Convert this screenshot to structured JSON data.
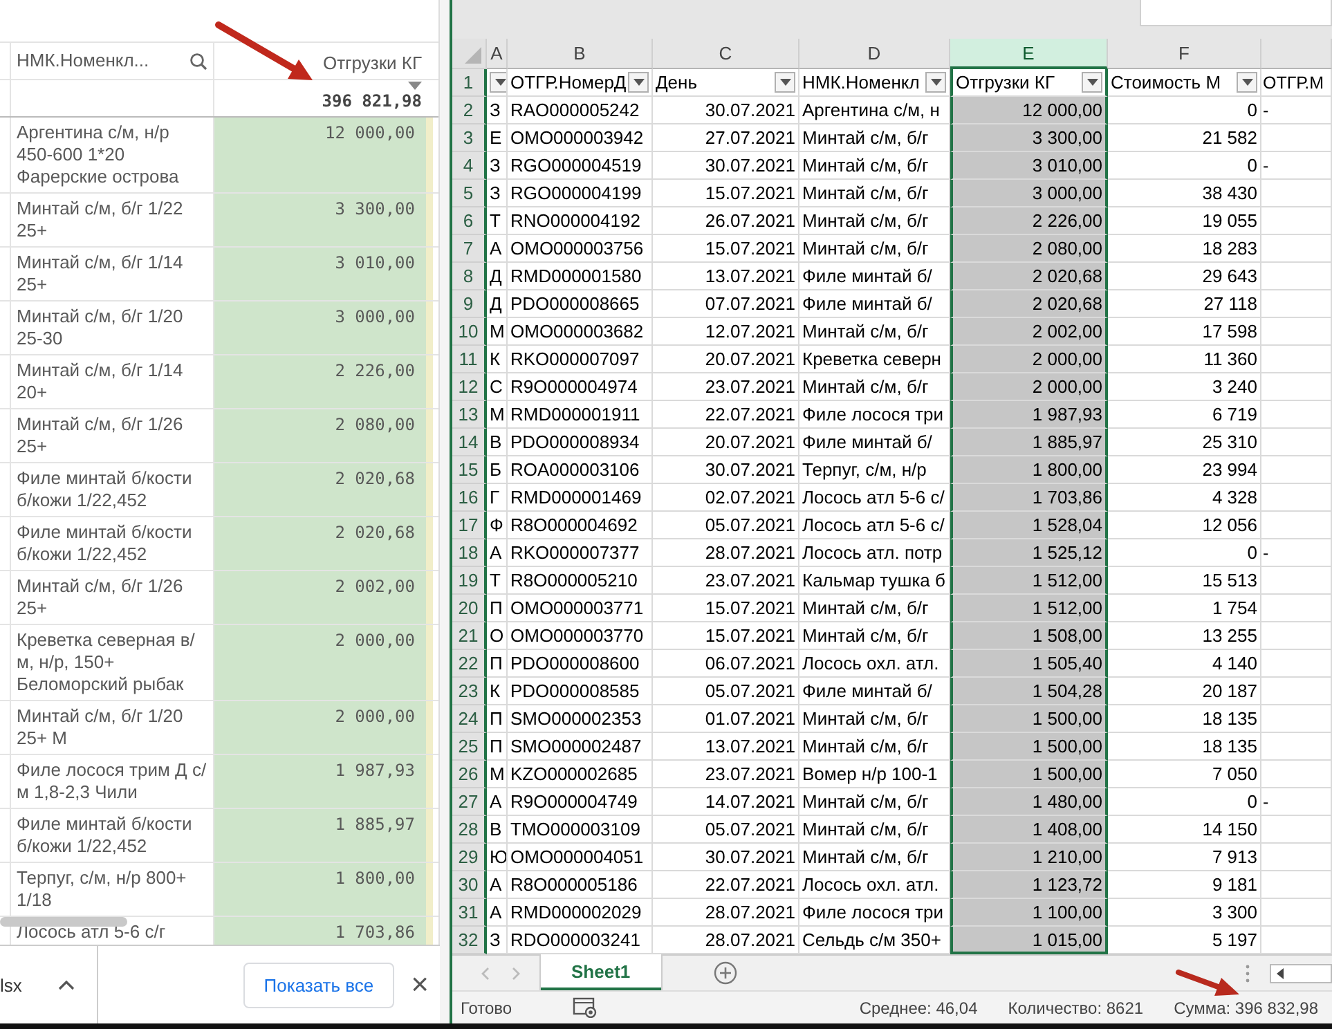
{
  "report_panel": {
    "columns": [
      {
        "label": "НМК.Номенкл..."
      },
      {
        "label": "Отгрузки КГ"
      }
    ],
    "total": "396 821,98",
    "rows": [
      {
        "name": "Аргентина с/м, н/р 450-600 1*20 Фарерские острова",
        "value": "12 000,00"
      },
      {
        "name": "Минтай с/м, б/г 1/22 25+",
        "value": "3 300,00"
      },
      {
        "name": "Минтай с/м, б/г 1/14 25+",
        "value": "3 010,00"
      },
      {
        "name": "Минтай с/м, б/г 1/20 25-30",
        "value": "3 000,00"
      },
      {
        "name": "Минтай с/м, б/г 1/14 20+",
        "value": "2 226,00"
      },
      {
        "name": "Минтай с/м, б/г 1/26 25+",
        "value": "2 080,00"
      },
      {
        "name": "Филе минтай б/кости б/кожи 1/22,452",
        "value": "2 020,68"
      },
      {
        "name": "Филе минтай б/кости б/кожи 1/22,452",
        "value": "2 020,68"
      },
      {
        "name": "Минтай с/м, б/г 1/26 25+",
        "value": "2 002,00"
      },
      {
        "name": "Креветка северная в/ м, н/р, 150+ Беломорский рыбак",
        "value": "2 000,00"
      },
      {
        "name": "Минтай с/м, б/г 1/20 25+ М",
        "value": "2 000,00"
      },
      {
        "name": "Филе лосося трим Д с/ м 1,8-2,3 Чили",
        "value": "1 987,93"
      },
      {
        "name": "Филе минтай б/кости б/кожи 1/22,452",
        "value": "1 885,97"
      },
      {
        "name": "Терпуг, с/м, н/р 800+ 1/18",
        "value": "1 800,00"
      },
      {
        "name": "Лосось атл 5-6 с/г",
        "value": "1 703,86"
      }
    ]
  },
  "download_bar": {
    "file_name": "lsx",
    "show_all_button": "Показать все",
    "close": "×"
  },
  "spreadsheet": {
    "column_letters": [
      {
        "letter": "A",
        "selected": false
      },
      {
        "letter": "B",
        "selected": false
      },
      {
        "letter": "C",
        "selected": false
      },
      {
        "letter": "D",
        "selected": false
      },
      {
        "letter": "E",
        "selected": true
      },
      {
        "letter": "F",
        "selected": false
      }
    ],
    "header_row": {
      "number": "1",
      "cells": [
        {
          "filter": true
        },
        {
          "label": "ОТГР.НомерД",
          "filter": true
        },
        {
          "label": "День",
          "filter": true
        },
        {
          "label": "НМК.Номенкл",
          "filter": true
        },
        {
          "label": "Отгрузки КГ",
          "filter": true
        },
        {
          "label": "Стоимость М",
          "filter": true
        },
        {
          "label": "ОТГР.М",
          "filter": false
        }
      ]
    },
    "rows": [
      {
        "number": "2",
        "cells": [
          "З",
          "RAO000005242",
          "30.07.2021",
          "Аргентина с/м, н",
          "12 000,00",
          "0"
        ],
        "column_7": "-"
      },
      {
        "number": "3",
        "cells": [
          "Е",
          "OMO000003942",
          "27.07.2021",
          "Минтай с/м, б/г",
          "3 300,00",
          "21 582"
        ]
      },
      {
        "number": "4",
        "cells": [
          "З",
          "RGO000004519",
          "30.07.2021",
          "Минтай с/м, б/г",
          "3 010,00",
          "0"
        ],
        "column_7": "-"
      },
      {
        "number": "5",
        "cells": [
          "З",
          "RGO000004199",
          "15.07.2021",
          "Минтай с/м, б/г",
          "3 000,00",
          "38 430"
        ]
      },
      {
        "number": "6",
        "cells": [
          "Т",
          "RNO000004192",
          "26.07.2021",
          "Минтай с/м, б/г",
          "2 226,00",
          "19 055"
        ]
      },
      {
        "number": "7",
        "cells": [
          "А",
          "OMO000003756",
          "15.07.2021",
          "Минтай с/м, б/г",
          "2 080,00",
          "18 283"
        ]
      },
      {
        "number": "8",
        "cells": [
          "Д",
          "RMD000001580",
          "13.07.2021",
          "Филе минтай б/",
          "2 020,68",
          "29 643"
        ]
      },
      {
        "number": "9",
        "cells": [
          "Д",
          "PDO000008665",
          "07.07.2021",
          "Филе минтай б/",
          "2 020,68",
          "27 118"
        ]
      },
      {
        "number": "10",
        "cells": [
          "М",
          "OMO000003682",
          "12.07.2021",
          "Минтай с/м, б/г",
          "2 002,00",
          "17 598"
        ]
      },
      {
        "number": "11",
        "cells": [
          "К",
          "RKO000007097",
          "20.07.2021",
          "Креветка северн",
          "2 000,00",
          "11 360"
        ]
      },
      {
        "number": "12",
        "cells": [
          "С",
          "R9O000004974",
          "23.07.2021",
          "Минтай с/м, б/г",
          "2 000,00",
          "3 240"
        ]
      },
      {
        "number": "13",
        "cells": [
          "М",
          "RMD000001911",
          "22.07.2021",
          "Филе лосося три",
          "1 987,93",
          "6 719"
        ]
      },
      {
        "number": "14",
        "cells": [
          "В",
          "PDO000008934",
          "20.07.2021",
          "Филе минтай б/",
          "1 885,97",
          "25 310"
        ]
      },
      {
        "number": "15",
        "cells": [
          "Б",
          "ROA000003106",
          "30.07.2021",
          "Терпуг, с/м, н/р",
          "1 800,00",
          "23 994"
        ]
      },
      {
        "number": "16",
        "cells": [
          "Г",
          "RMD000001469",
          "02.07.2021",
          "Лосось атл 5-6 с/",
          "1 703,86",
          "4 328"
        ]
      },
      {
        "number": "17",
        "cells": [
          "Ф",
          "R8O000004692",
          "05.07.2021",
          "Лосось атл 5-6 с/",
          "1 528,04",
          "12 056"
        ]
      },
      {
        "number": "18",
        "cells": [
          "А",
          "RKO000007377",
          "28.07.2021",
          "Лосось атл. потр",
          "1 525,12",
          "0"
        ],
        "column_7": "-"
      },
      {
        "number": "19",
        "cells": [
          "Т",
          "R8O000005210",
          "23.07.2021",
          "Кальмар тушка б",
          "1 512,00",
          "15 513"
        ]
      },
      {
        "number": "20",
        "cells": [
          "П",
          "OMO000003771",
          "15.07.2021",
          "Минтай с/м, б/г",
          "1 512,00",
          "1 754"
        ]
      },
      {
        "number": "21",
        "cells": [
          "О",
          "OMO000003770",
          "15.07.2021",
          "Минтай с/м, б/г",
          "1 508,00",
          "13 255"
        ]
      },
      {
        "number": "22",
        "cells": [
          "П",
          "PDO000008600",
          "06.07.2021",
          "Лосось охл. атл.",
          "1 505,40",
          "4 140"
        ]
      },
      {
        "number": "23",
        "cells": [
          "К",
          "PDO000008585",
          "05.07.2021",
          "Филе минтай б/",
          "1 504,28",
          "20 187"
        ]
      },
      {
        "number": "24",
        "cells": [
          "П",
          "SMO000002353",
          "01.07.2021",
          "Минтай с/м, б/г",
          "1 500,00",
          "18 135"
        ]
      },
      {
        "number": "25",
        "cells": [
          "П",
          "SMO000002487",
          "13.07.2021",
          "Минтай с/м, б/г",
          "1 500,00",
          "18 135"
        ]
      },
      {
        "number": "26",
        "cells": [
          "М",
          "KZO000002685",
          "23.07.2021",
          "Вомер н/р 100-1",
          "1 500,00",
          "7 050"
        ]
      },
      {
        "number": "27",
        "cells": [
          "А",
          "R9O000004749",
          "14.07.2021",
          "Минтай с/м, б/г",
          "1 480,00",
          "0"
        ],
        "column_7": "-"
      },
      {
        "number": "28",
        "cells": [
          "В",
          "TMO000003109",
          "05.07.2021",
          "Минтай с/м, б/г",
          "1 408,00",
          "14 150"
        ]
      },
      {
        "number": "29",
        "cells": [
          "Ю",
          "OMO000004051",
          "30.07.2021",
          "Минтай с/м, б/г",
          "1 210,00",
          "7 913"
        ]
      },
      {
        "number": "30",
        "cells": [
          "А",
          "R8O000005186",
          "22.07.2021",
          "Лосось охл. атл.",
          "1 123,72",
          "9 181"
        ]
      },
      {
        "number": "31",
        "cells": [
          "А",
          "RMD000002029",
          "28.07.2021",
          "Филе лосося три",
          "1 100,00",
          "3 300"
        ]
      },
      {
        "number": "32",
        "cells": [
          "З",
          "RDO000003241",
          "28.07.2021",
          "Сельдь с/м 350+",
          "1 015,00",
          "5 197"
        ]
      }
    ],
    "sheet_tabs": [
      {
        "label": "Sheet1",
        "selected": true
      }
    ],
    "status_bar": {
      "ready": "Готово",
      "average": "Среднее: 46,04",
      "count": "Количество: 8621",
      "sum": "Сумма: 396 832,98"
    }
  }
}
